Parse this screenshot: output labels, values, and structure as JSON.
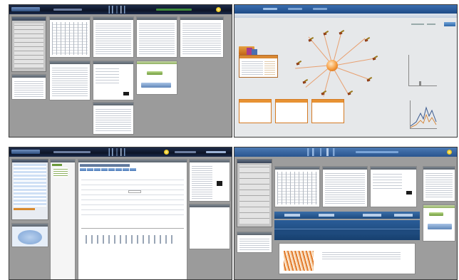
{
  "screens": [
    {
      "id": "calendar-dashboard",
      "kind": "dashboard"
    },
    {
      "id": "relationship-graph",
      "kind": "graph"
    },
    {
      "id": "record-editor",
      "kind": "form"
    },
    {
      "id": "dashboard-with-reports",
      "kind": "dashboard"
    }
  ],
  "colors": {
    "header_dark": "#0d1528",
    "header_blue": "#1d4a86",
    "accent_orange": "#e07b1b",
    "accent_green": "#6f9a3b",
    "panel_gray": "#9b9b9b"
  },
  "icons": [
    "sun-logo-icon",
    "user-node-icon",
    "chart-icon"
  ]
}
